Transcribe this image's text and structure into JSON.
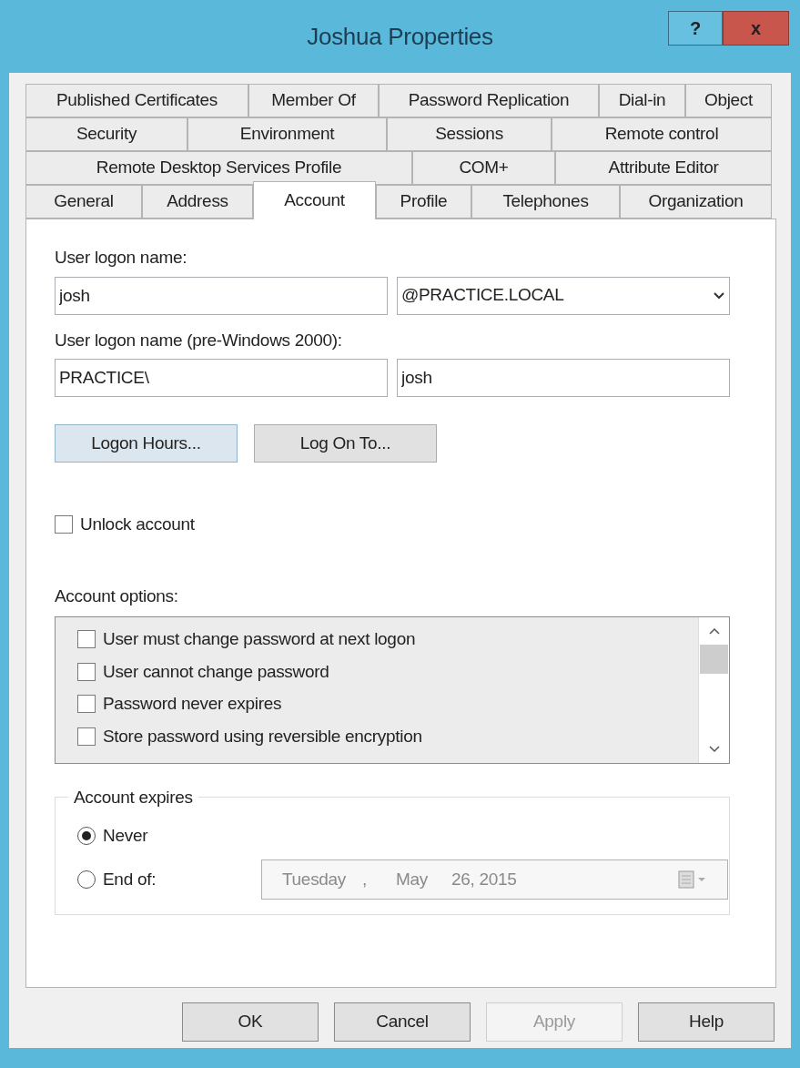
{
  "window": {
    "title": "Joshua Properties",
    "help_button": "?",
    "close_button": "x"
  },
  "tab_rows": [
    [
      {
        "label": "Published Certificates",
        "selected": false
      },
      {
        "label": "Member Of",
        "selected": false
      },
      {
        "label": "Password Replication",
        "selected": false
      },
      {
        "label": "Dial-in",
        "selected": false
      },
      {
        "label": "Object",
        "selected": false
      }
    ],
    [
      {
        "label": "Security",
        "selected": false
      },
      {
        "label": "Environment",
        "selected": false
      },
      {
        "label": "Sessions",
        "selected": false
      },
      {
        "label": "Remote control",
        "selected": false
      }
    ],
    [
      {
        "label": "Remote Desktop Services Profile",
        "selected": false
      },
      {
        "label": "COM+",
        "selected": false
      },
      {
        "label": "Attribute Editor",
        "selected": false
      }
    ],
    [
      {
        "label": "General",
        "selected": false
      },
      {
        "label": "Address",
        "selected": false
      },
      {
        "label": "Account",
        "selected": true
      },
      {
        "label": "Profile",
        "selected": false
      },
      {
        "label": "Telephones",
        "selected": false
      },
      {
        "label": "Organization",
        "selected": false
      }
    ]
  ],
  "logon_name": {
    "label": "User logon name:",
    "value": "josh",
    "domain": "@PRACTICE.LOCAL"
  },
  "pre2000": {
    "label": "User logon name (pre-Windows 2000):",
    "domain": "PRACTICE\\",
    "value": "josh"
  },
  "logon_buttons": [
    {
      "label": "Logon Hours...",
      "focused": true
    },
    {
      "label": "Log On To...",
      "focused": false
    }
  ],
  "unlock": {
    "label": "Unlock account",
    "checked": false
  },
  "account_options": {
    "label": "Account options:",
    "items": [
      {
        "label": "User must change password at next logon",
        "checked": false
      },
      {
        "label": "User cannot change password",
        "checked": false
      },
      {
        "label": "Password never expires",
        "checked": false
      },
      {
        "label": "Store password using reversible encryption",
        "checked": false
      }
    ]
  },
  "account_expires": {
    "label": "Account expires",
    "options": [
      {
        "label": "Never",
        "selected": true
      },
      {
        "label": "End of:",
        "selected": false
      }
    ],
    "date": {
      "weekday": "Tuesday",
      "sep": ",",
      "month": "May",
      "day_year": "26, 2015",
      "disabled": true
    }
  },
  "buttons": [
    {
      "label": "OK",
      "disabled": false
    },
    {
      "label": "Cancel",
      "disabled": false
    },
    {
      "label": "Apply",
      "disabled": true
    },
    {
      "label": "Help",
      "disabled": false
    }
  ]
}
